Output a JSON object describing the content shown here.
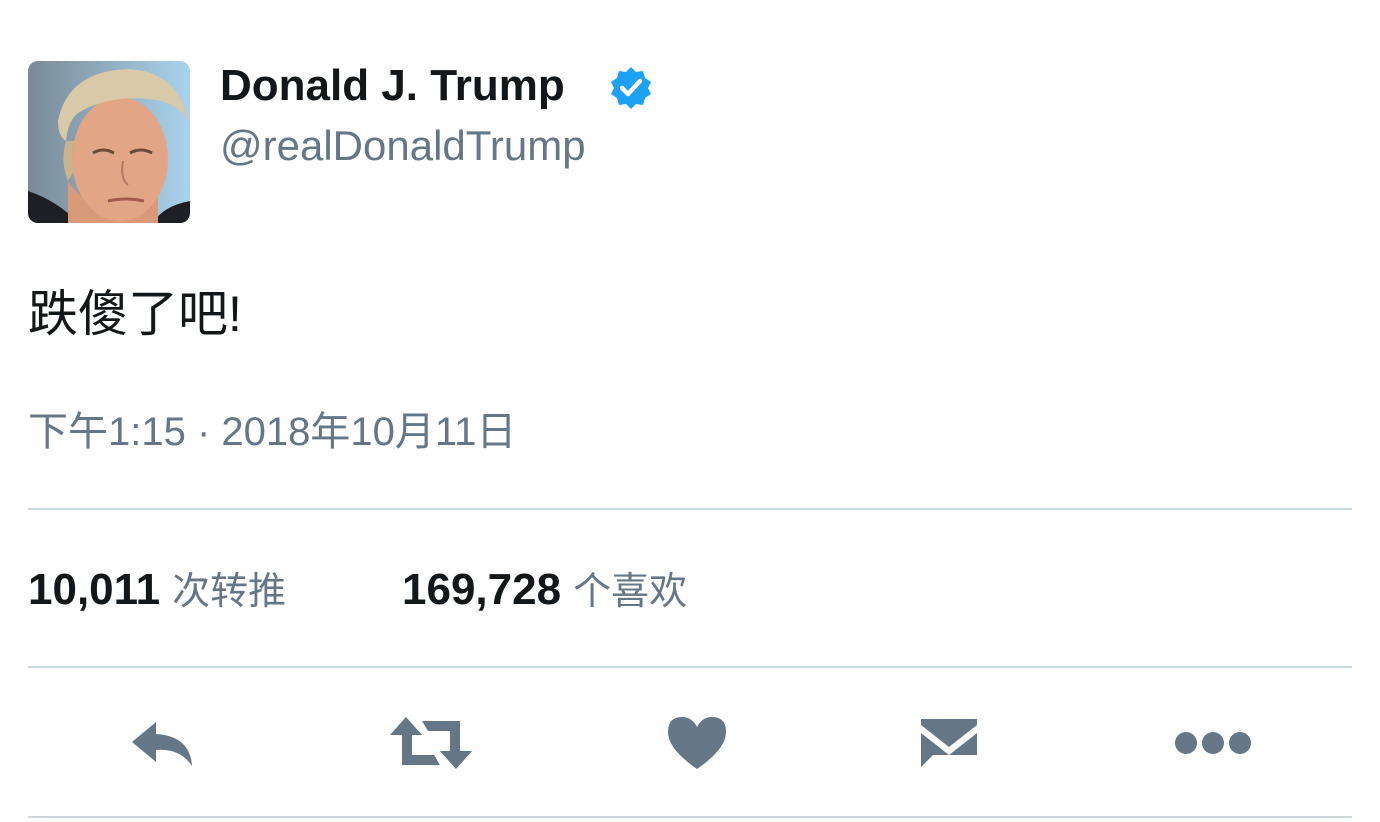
{
  "author": {
    "display_name": "Donald J. Trump",
    "handle": "@realDonaldTrump",
    "verified": true
  },
  "tweet": {
    "text": "跌傻了吧!",
    "timestamp": "下午1:15 · 2018年10月11日"
  },
  "stats": {
    "retweets_count": "10,011",
    "retweets_label": "次转推",
    "likes_count": "169,728",
    "likes_label": "个喜欢"
  },
  "actions": [
    {
      "name": "reply",
      "icon": "reply-icon"
    },
    {
      "name": "retweet",
      "icon": "retweet-icon"
    },
    {
      "name": "like",
      "icon": "heart-icon"
    },
    {
      "name": "direct-message",
      "icon": "envelope-icon"
    },
    {
      "name": "more",
      "icon": "more-dots-icon"
    }
  ],
  "colors": {
    "text_primary": "#14171a",
    "text_secondary": "#657786",
    "divider": "#ccd6dd",
    "verified_blue": "#1da1f2",
    "icon_gray": "#657786"
  }
}
